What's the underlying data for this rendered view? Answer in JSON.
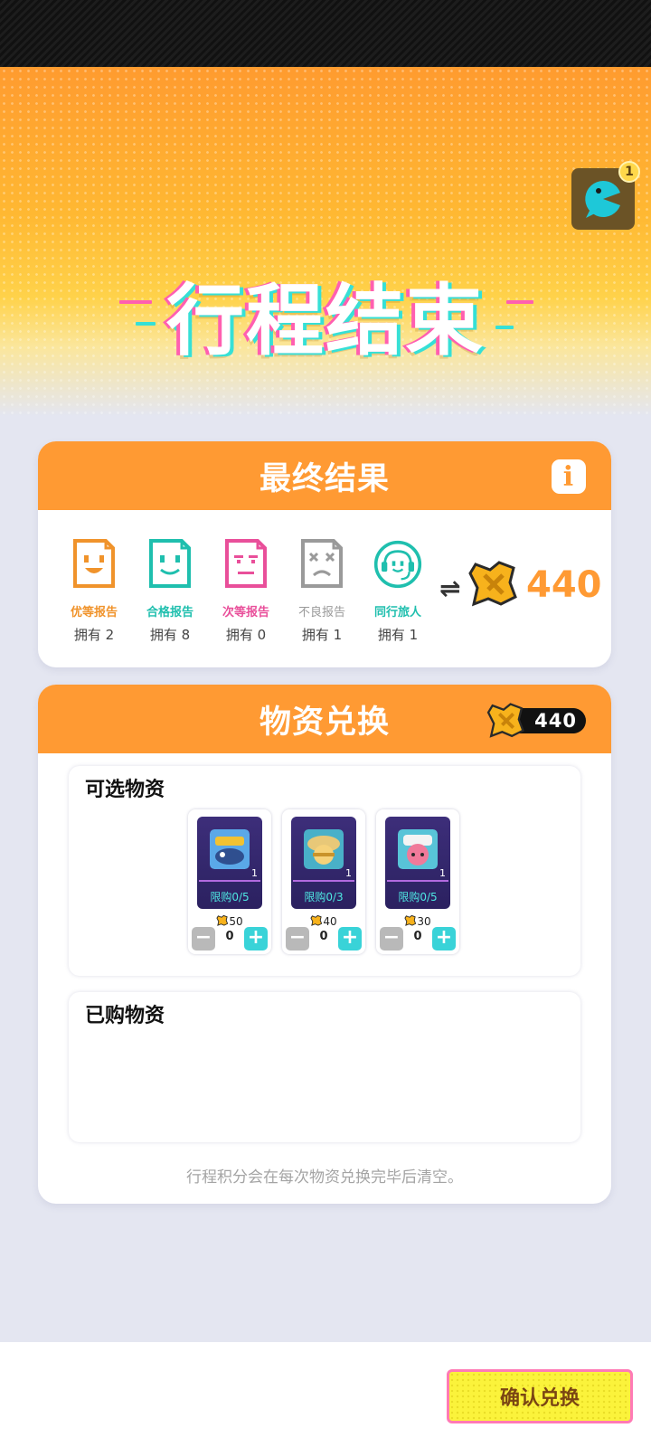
{
  "hero": {
    "title": "行程结束",
    "notification_count": "1"
  },
  "result": {
    "title": "最终结果",
    "info_label": "i",
    "reports": [
      {
        "label": "优等报告",
        "count": "拥有 2",
        "color": "#f0932b",
        "icon": "happy-report-icon"
      },
      {
        "label": "合格报告",
        "count": "拥有 8",
        "color": "#1fbfae",
        "icon": "smile-report-icon"
      },
      {
        "label": "次等报告",
        "count": "拥有 0",
        "color": "#e94f9a",
        "icon": "meh-report-icon"
      },
      {
        "label": "不良报告",
        "count": "拥有 1",
        "color": "#9a9a9a",
        "icon": "sad-report-icon"
      },
      {
        "label": "同行旅人",
        "count": "拥有 1",
        "color": "#1fbfae",
        "icon": "headset-traveler-icon"
      }
    ],
    "exchange_symbol": "⇌",
    "total_points": "440"
  },
  "exchange": {
    "title": "物资兑换",
    "balance": "440",
    "available_title": "可选物资",
    "items": [
      {
        "qty": "1",
        "limit": "限购0/5",
        "price": "50",
        "count": "0",
        "portrait": "diver-fish-portrait"
      },
      {
        "qty": "1",
        "limit": "限购0/3",
        "price": "40",
        "count": "0",
        "portrait": "hat-girl-portrait"
      },
      {
        "qty": "1",
        "limit": "限购0/5",
        "price": "30",
        "count": "0",
        "portrait": "pink-hair-portrait"
      }
    ],
    "purchased_title": "已购物资",
    "note": "行程积分会在每次物资兑换完毕后清空。"
  },
  "footer": {
    "confirm_label": "确认兑换"
  },
  "colors": {
    "accent": "#ff9a33",
    "cyan": "#39d3d8",
    "pink": "#ff5fb0",
    "yellow": "#fbf33b"
  }
}
